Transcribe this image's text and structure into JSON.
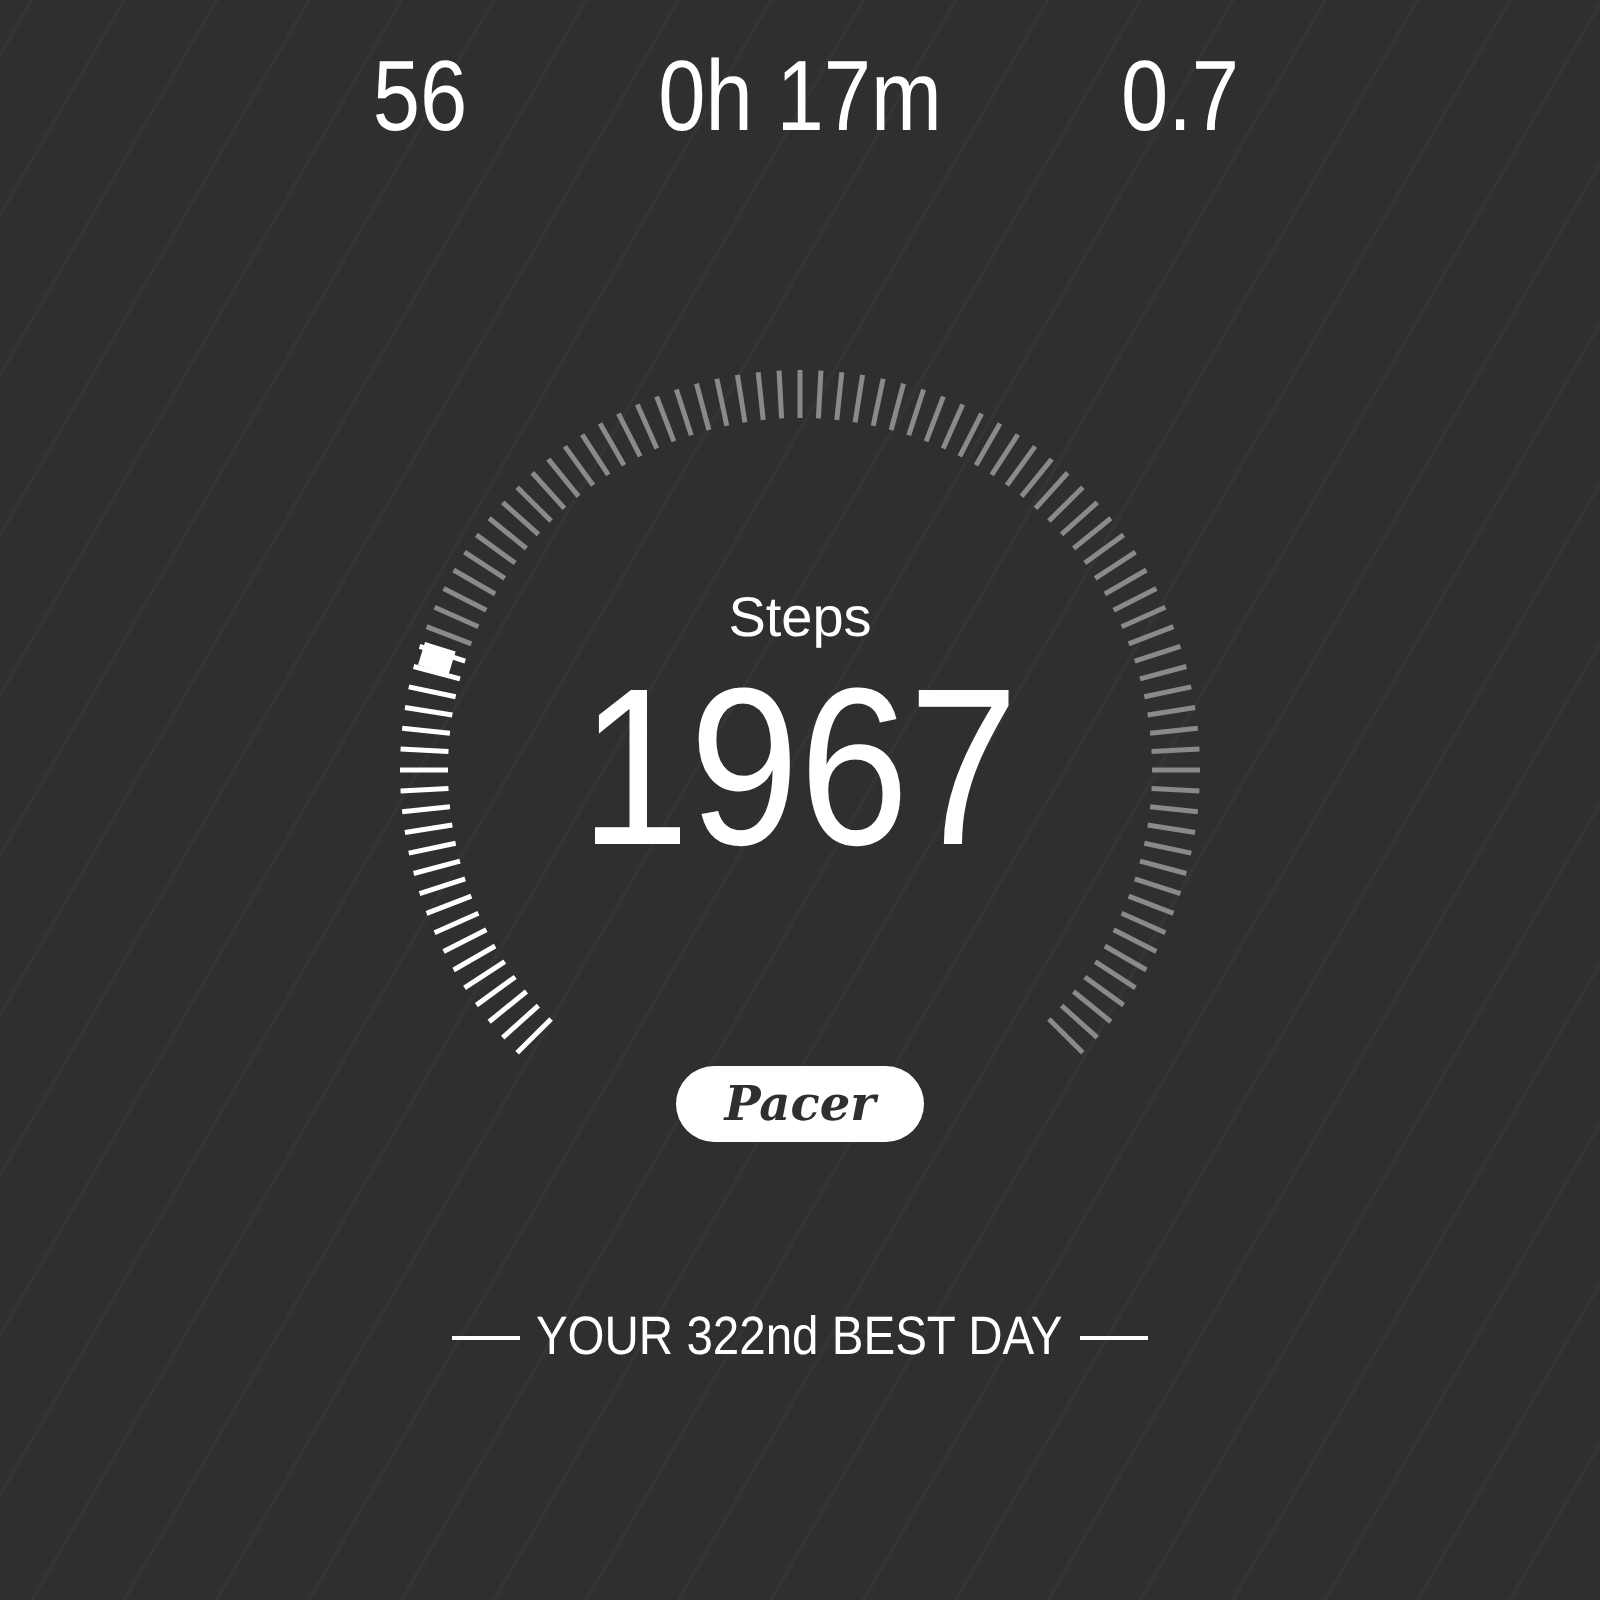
{
  "stats": [
    {
      "value": "56"
    },
    {
      "value": "0h 17m"
    },
    {
      "value": "0.7"
    }
  ],
  "gauge": {
    "label": "Steps",
    "value": "1967"
  },
  "badge": "Pacer",
  "footer": "YOUR 322nd BEST DAY"
}
